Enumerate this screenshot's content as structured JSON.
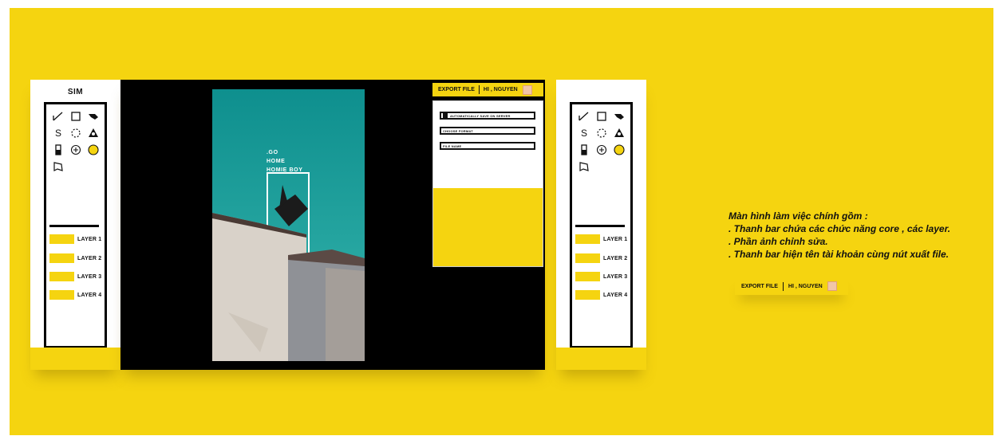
{
  "app": {
    "title": "SIM"
  },
  "tools": [
    {
      "icon": "line-tool-icon",
      "glyph": "◸"
    },
    {
      "icon": "rectangle-tool-icon",
      "glyph": "□"
    },
    {
      "icon": "pen-tool-icon",
      "glyph": "✎"
    },
    {
      "icon": "s-curve-tool-icon",
      "glyph": "S"
    },
    {
      "icon": "lasso-tool-icon",
      "glyph": "◌"
    },
    {
      "icon": "fill-tool-icon",
      "glyph": "◭"
    },
    {
      "icon": "crop-tool-icon",
      "glyph": "▬"
    },
    {
      "icon": "add-tool-icon",
      "glyph": "⊕"
    },
    {
      "icon": "color-picker-icon",
      "glyph": ""
    },
    {
      "icon": "eraser-tool-icon",
      "glyph": "◿"
    }
  ],
  "layers": [
    "LAYER 1",
    "LAYER 2",
    "LAYER 3",
    "LAYER 4"
  ],
  "photo": {
    "line1": ".GO",
    "line2": "HOME",
    "line3": "HOMIE BOY"
  },
  "export": {
    "button_label": "EXPORT FILE",
    "greeting": "HI , NGUYEN",
    "options": {
      "auto_save": "AUTOMATICALLY SAVE ON SERVER",
      "format": "CHOOSE FORMAT",
      "file_name": "FILE NAME"
    }
  },
  "description": {
    "line1": "Màn hình làm việc chính gồm :",
    "line2": ". Thanh bar chứa các chức năng core , các layer.",
    "line3": " . Phần ảnh chỉnh sửa.",
    "line4": ". Thanh bar hiện tên tài khoản cùng nút xuất file."
  },
  "colors": {
    "accent": "#f5d410",
    "workspace": "#000000",
    "photo_sky": "#1aa3a0"
  }
}
